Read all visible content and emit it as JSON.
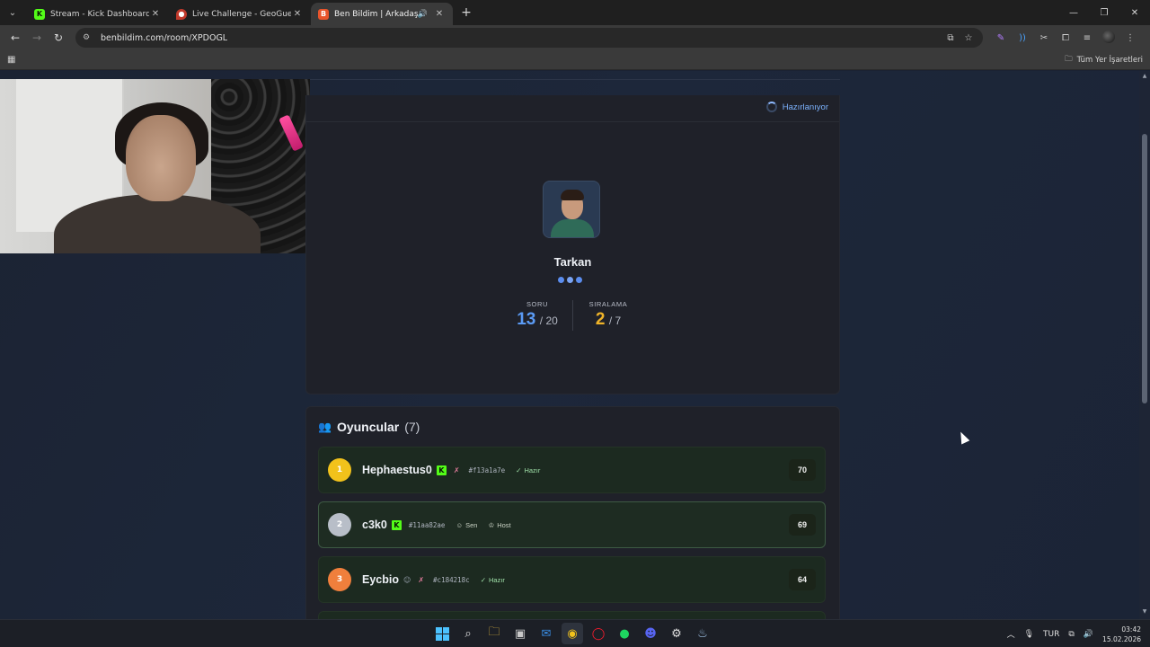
{
  "browser": {
    "tabs": [
      {
        "title": "Stream - Kick Dashboard",
        "favicon": "kick-icon",
        "active": false
      },
      {
        "title": "Live Challenge - GeoGuessr",
        "favicon": "geoguessr-pin-icon",
        "active": false
      },
      {
        "title": "Ben Bildim | Arkadaşlarınla",
        "favicon": "benbildim-icon",
        "active": true
      }
    ],
    "new_tab": "+",
    "url": "benbildim.com/room/XPDOGL",
    "bookmarks_all": "Tüm Yer İşaretleri"
  },
  "quiz": {
    "status": "Hazırlanıyor",
    "player_name": "Tarkan",
    "question_label": "SORU",
    "question_current": "13",
    "question_total": "/ 20",
    "rank_label": "SIRALAMA",
    "rank_current": "2",
    "rank_total": "/ 7"
  },
  "players": {
    "title": "Oyuncular",
    "count": "(7)",
    "list": [
      {
        "rank": "1",
        "name": "Hephaestus0",
        "id": "#f13a1a7e",
        "tag1": "",
        "tag2": "Hazır",
        "score": "70"
      },
      {
        "rank": "2",
        "name": "c3k0",
        "id": "#11aa82ae",
        "tag1": "Sen",
        "tag2": "Host",
        "score": "69"
      },
      {
        "rank": "3",
        "name": "Eycbio",
        "id": "#c184218c",
        "tag1": "",
        "tag2": "Hazır",
        "score": "64"
      }
    ]
  },
  "taskbar": {
    "language": "TUR",
    "time": "03:42",
    "date": "15.02.2026"
  },
  "colors": {
    "accent_blue": "#5b9bf5",
    "accent_gold": "#f0b429",
    "kick_green": "#53fc18",
    "ready_green": "#9fe0a8"
  }
}
